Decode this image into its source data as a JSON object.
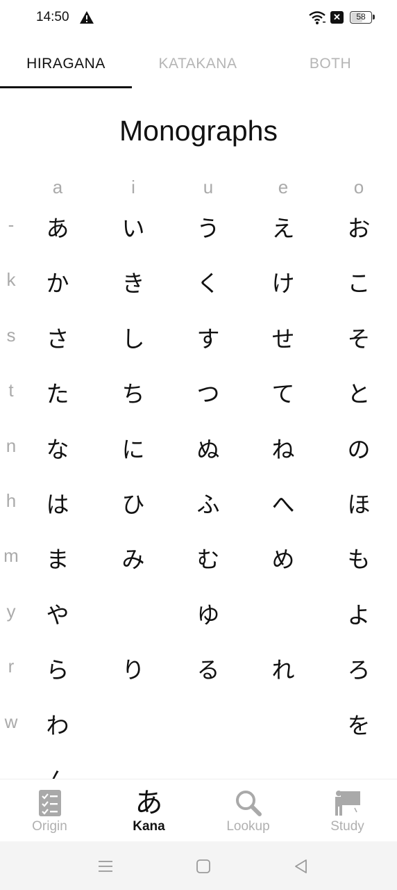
{
  "status_bar": {
    "time": "14:50",
    "battery": "58",
    "battery_level": 0.58,
    "icons": [
      "warning-icon",
      "wifi-icon",
      "x-box-icon",
      "battery-icon"
    ]
  },
  "tabs": [
    {
      "label": "HIRAGANA",
      "active": true
    },
    {
      "label": "KATAKANA",
      "active": false
    },
    {
      "label": "BOTH",
      "active": false
    }
  ],
  "page_title": "Monographs",
  "kana_table": {
    "columns": [
      "a",
      "i",
      "u",
      "e",
      "o"
    ],
    "rows": [
      {
        "label": "-",
        "cells": [
          "あ",
          "い",
          "う",
          "え",
          "お"
        ]
      },
      {
        "label": "k",
        "cells": [
          "か",
          "き",
          "く",
          "け",
          "こ"
        ]
      },
      {
        "label": "s",
        "cells": [
          "さ",
          "し",
          "す",
          "せ",
          "そ"
        ]
      },
      {
        "label": "t",
        "cells": [
          "た",
          "ち",
          "つ",
          "て",
          "と"
        ]
      },
      {
        "label": "n",
        "cells": [
          "な",
          "に",
          "ぬ",
          "ね",
          "の"
        ]
      },
      {
        "label": "h",
        "cells": [
          "は",
          "ひ",
          "ふ",
          "へ",
          "ほ"
        ]
      },
      {
        "label": "m",
        "cells": [
          "ま",
          "み",
          "む",
          "め",
          "も"
        ]
      },
      {
        "label": "y",
        "cells": [
          "や",
          "",
          "ゆ",
          "",
          "よ"
        ]
      },
      {
        "label": "r",
        "cells": [
          "ら",
          "り",
          "る",
          "れ",
          "ろ"
        ]
      },
      {
        "label": "w",
        "cells": [
          "わ",
          "",
          "",
          "",
          "を"
        ]
      },
      {
        "label": "",
        "cells": [
          "ん",
          "",
          "",
          "",
          ""
        ]
      }
    ]
  },
  "bottom_nav": [
    {
      "label": "Origin",
      "icon": "checklist-icon",
      "active": false
    },
    {
      "label": "Kana",
      "icon": "a-hiragana-icon",
      "glyph": "あ",
      "active": true
    },
    {
      "label": "Lookup",
      "icon": "search-icon",
      "active": false
    },
    {
      "label": "Study",
      "icon": "teacher-board-icon",
      "active": false
    }
  ],
  "system_nav": {
    "buttons": [
      "recents-button",
      "home-button",
      "back-button"
    ]
  },
  "colors": {
    "text": "#111111",
    "muted": "#aaaaaa",
    "inactive_tab": "#b5b5b5",
    "nav_inactive": "#b0b0b0",
    "background": "#ffffff",
    "system_bar": "#f4f4f4"
  }
}
